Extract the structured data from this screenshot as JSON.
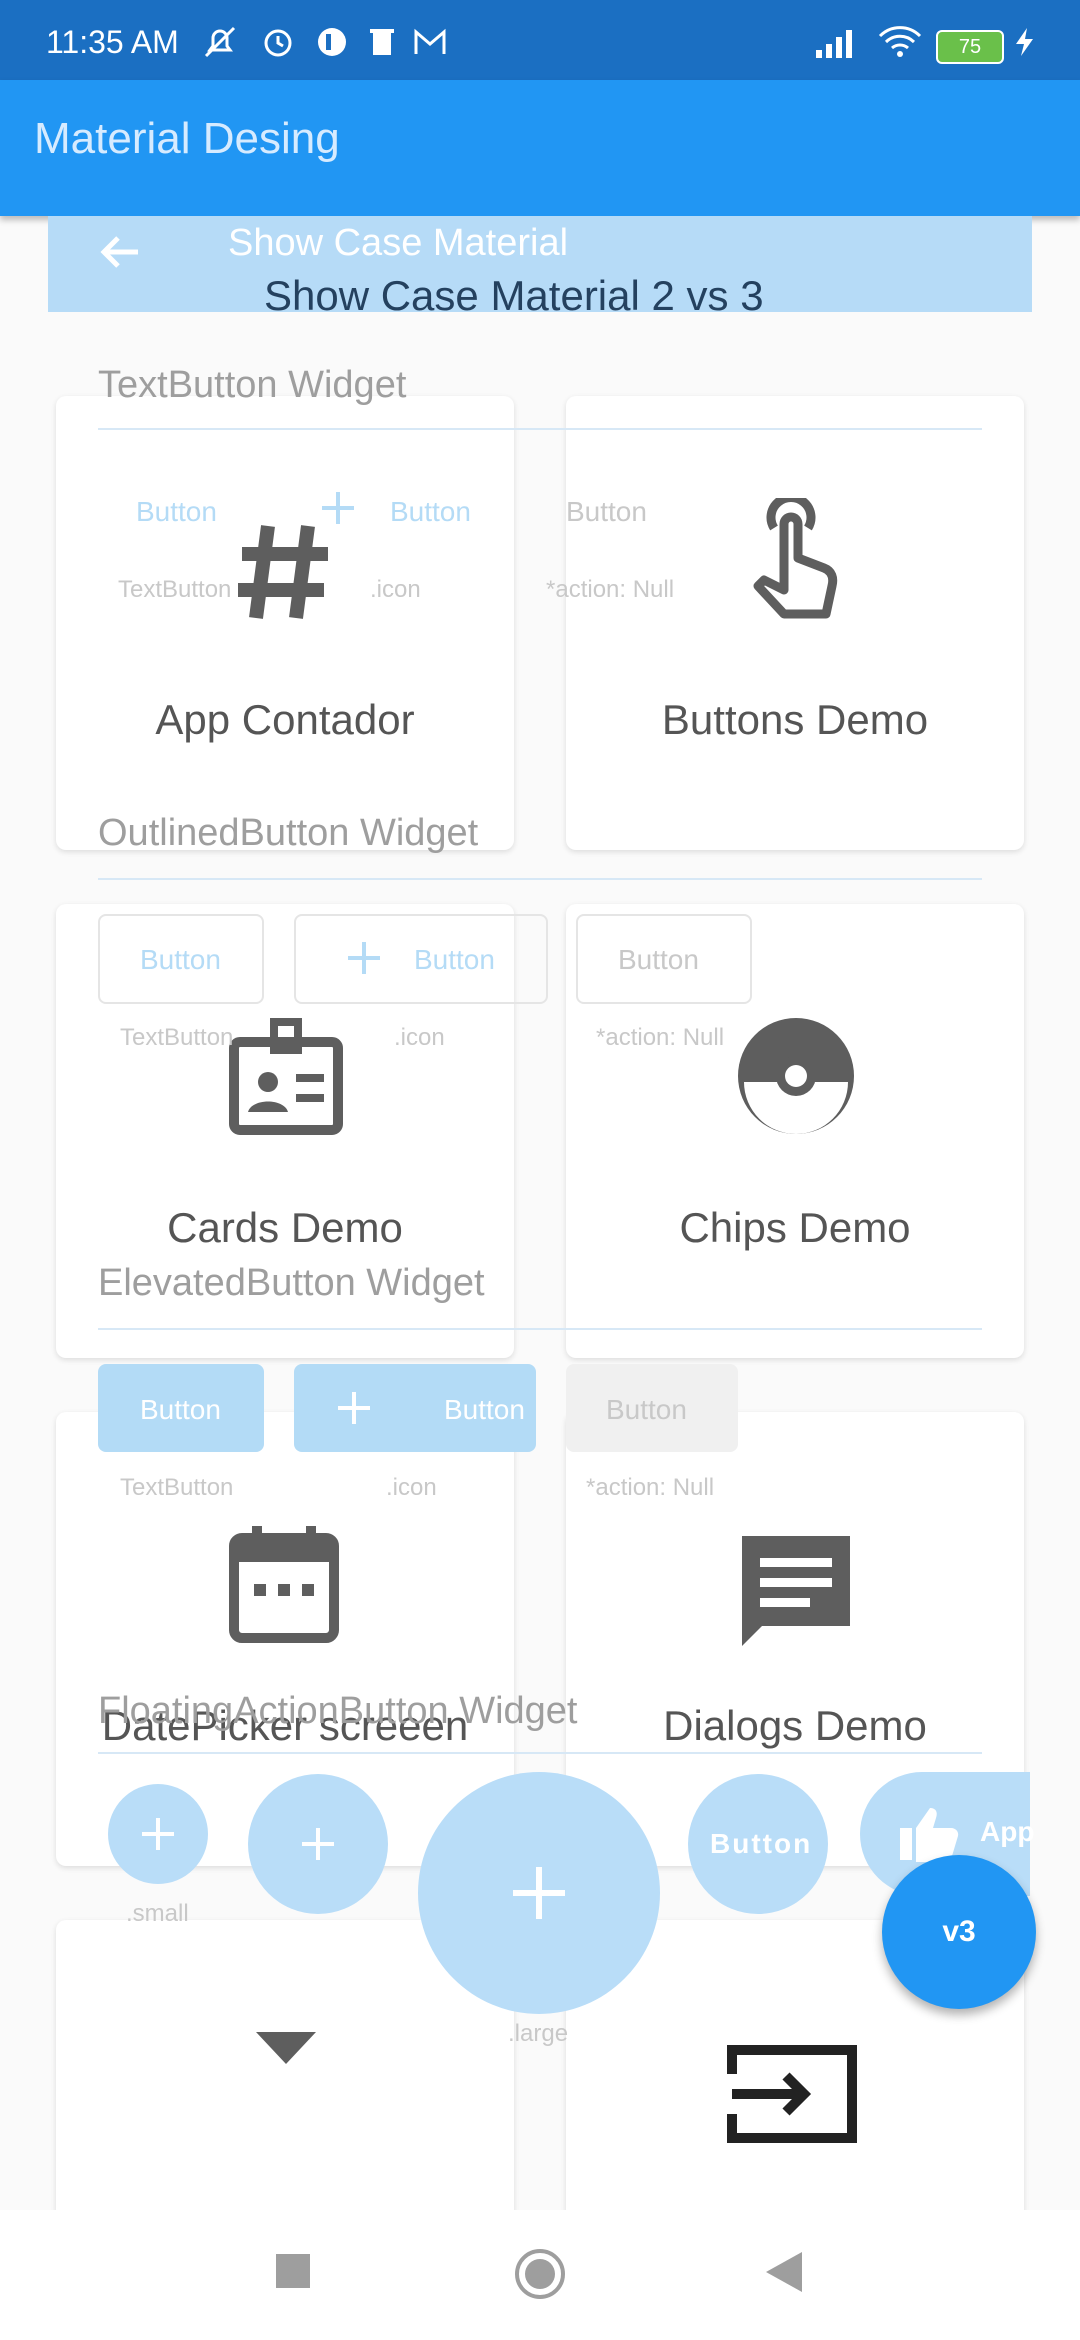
{
  "status_bar": {
    "time": "11:35 AM",
    "battery": "75"
  },
  "app_bar": {
    "title": "Material Desing"
  },
  "overlay": {
    "line1": "Show Case Material",
    "line2": "Show Case Material 2 vs 3"
  },
  "cards": [
    {
      "label": "App Contador",
      "icon": "hash-icon"
    },
    {
      "label": "Buttons Demo",
      "icon": "touch-icon"
    },
    {
      "label": "Cards Demo",
      "icon": "badge-icon"
    },
    {
      "label": "Chips Demo",
      "icon": "pokeball-icon"
    },
    {
      "label": "DatePicker screeen",
      "icon": "calendar-icon"
    },
    {
      "label": "Dialogs Demo",
      "icon": "message-icon"
    }
  ],
  "sections": {
    "text_button": "TextButton Widget",
    "outlined_button": "OutlinedButton Widget",
    "elevated_button": "ElevatedButton Widget",
    "fab": "FloatingActionButton Widget"
  },
  "buttons": {
    "label": "Button",
    "caption_text": "TextButton",
    "caption_icon": ".icon",
    "caption_null": "*action: Null",
    "caption_small": ".small",
    "caption_large": ".large",
    "extended_label": "App"
  },
  "fab_main": {
    "label": "v3"
  }
}
